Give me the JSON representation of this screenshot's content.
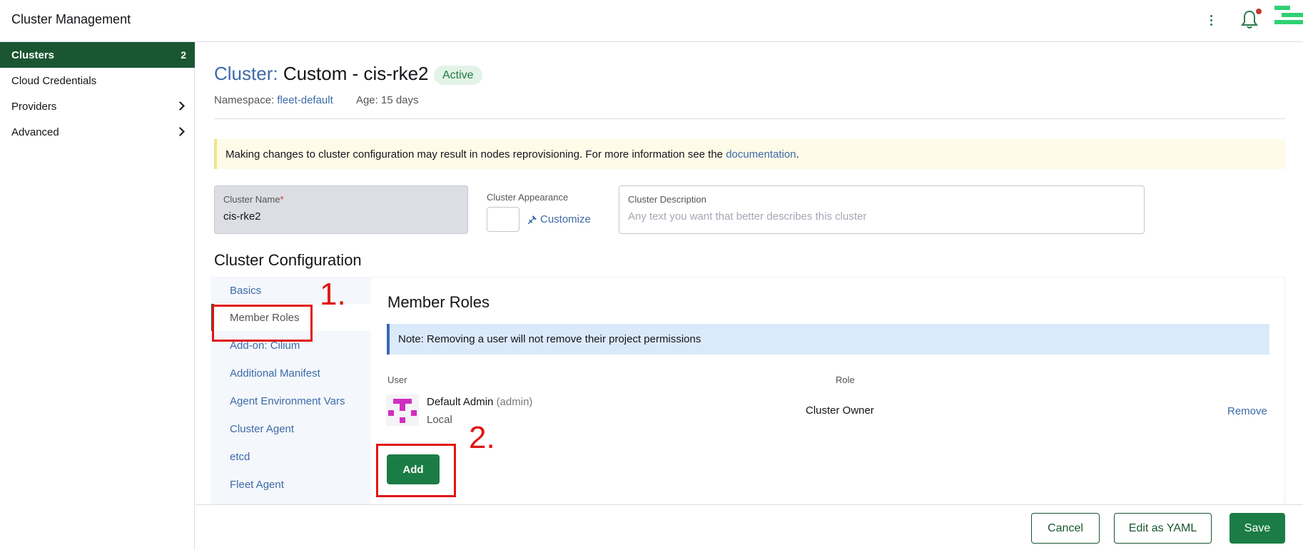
{
  "header": {
    "app_title": "Cluster Management"
  },
  "sidebar": {
    "items": [
      {
        "label": "Clusters",
        "count": "2",
        "active": true
      },
      {
        "label": "Cloud Credentials"
      },
      {
        "label": "Providers",
        "expandable": true
      },
      {
        "label": "Advanced",
        "expandable": true
      }
    ]
  },
  "cluster": {
    "title_label": "Cluster:",
    "title_name": "Custom - cis-rke2",
    "status": "Active",
    "namespace_label": "Namespace:",
    "namespace_value": "fleet-default",
    "age": "Age: 15 days"
  },
  "banner": {
    "text": "Making changes to cluster configuration may result in nodes reprovisioning. For more information see the ",
    "link": "documentation",
    "suffix": "."
  },
  "form": {
    "name_label": "Cluster Name",
    "name_required": "*",
    "name_value": "cis-rke2",
    "appearance_label": "Cluster Appearance",
    "customize_label": "Customize",
    "description_label": "Cluster Description",
    "description_placeholder": "Any text you want that better describes this cluster"
  },
  "config": {
    "title": "Cluster Configuration",
    "tabs": [
      {
        "label": "Basics"
      },
      {
        "label": "Member Roles",
        "active": true
      },
      {
        "label": "Add-on: Cilium"
      },
      {
        "label": "Additional Manifest"
      },
      {
        "label": "Agent Environment Vars"
      },
      {
        "label": "Cluster Agent"
      },
      {
        "label": "etcd"
      },
      {
        "label": "Fleet Agent"
      }
    ]
  },
  "member_roles": {
    "title": "Member Roles",
    "note": "Note: Removing a user will not remove their project permissions",
    "col_user": "User",
    "col_role": "Role",
    "rows": [
      {
        "name": "Default Admin",
        "id": "(admin)",
        "source": "Local",
        "role": "Cluster Owner",
        "action": "Remove"
      }
    ],
    "add_label": "Add"
  },
  "annotations": {
    "step1": "1.",
    "step2": "2."
  },
  "footer": {
    "cancel": "Cancel",
    "edit_yaml": "Edit as YAML",
    "save": "Save"
  },
  "colors": {
    "brand_green": "#1a5632",
    "button_green": "#1b7d45",
    "link_blue": "#3d6aa8",
    "annotation_red": "#e01616"
  }
}
